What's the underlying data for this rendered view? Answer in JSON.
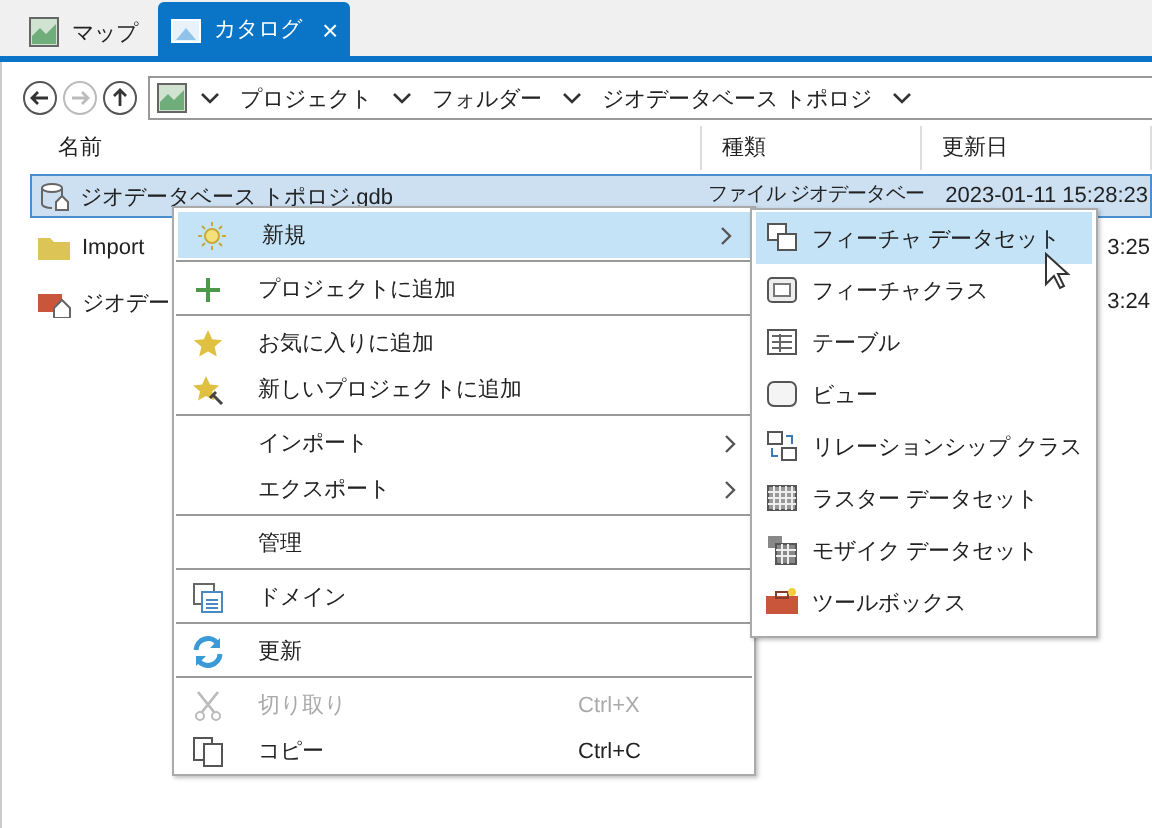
{
  "tabs": [
    {
      "label": "マップ",
      "selected": false
    },
    {
      "label": "カタログ",
      "selected": true,
      "close": "×"
    }
  ],
  "breadcrumb": {
    "items": [
      "プロジェクト",
      "フォルダー",
      "ジオデータベース トポロジ"
    ]
  },
  "table": {
    "columns": [
      "名前",
      "種類",
      "更新日"
    ],
    "rows": [
      {
        "name": "ジオデータベース トポロジ.gdb",
        "type": "ファイル ジオデータベー",
        "modified": "2023-01-11 15:28:23",
        "selected": true
      },
      {
        "name": "Import",
        "modified": "3:25",
        "selected": false
      },
      {
        "name": "ジオデー",
        "modified": "3:24",
        "selected": false
      }
    ]
  },
  "context_menu": {
    "items": [
      {
        "kind": "item",
        "label": "新規",
        "selected": true,
        "submenu": true
      },
      {
        "kind": "separator"
      },
      {
        "kind": "item",
        "label": "プロジェクトに追加",
        "selected": false,
        "submenu": false
      },
      {
        "kind": "separator"
      },
      {
        "kind": "item",
        "label": "お気に入りに追加",
        "selected": false,
        "submenu": false
      },
      {
        "kind": "item",
        "label": "新しいプロジェクトに追加",
        "selected": false,
        "submenu": false
      },
      {
        "kind": "separator"
      },
      {
        "kind": "item",
        "label": "インポート",
        "selected": false,
        "submenu": true
      },
      {
        "kind": "item",
        "label": "エクスポート",
        "selected": false,
        "submenu": true
      },
      {
        "kind": "separator"
      },
      {
        "kind": "item",
        "label": "管理",
        "selected": false,
        "submenu": false
      },
      {
        "kind": "separator"
      },
      {
        "kind": "item",
        "label": "ドメイン",
        "selected": false,
        "submenu": false
      },
      {
        "kind": "separator"
      },
      {
        "kind": "item",
        "label": "更新",
        "selected": false,
        "submenu": false
      },
      {
        "kind": "separator"
      },
      {
        "kind": "item",
        "label": "切り取り",
        "shortcut": "Ctrl+X",
        "disabled": true,
        "selected": false,
        "submenu": false
      },
      {
        "kind": "item",
        "label": "コピー",
        "shortcut": "Ctrl+C",
        "selected": false,
        "submenu": false
      }
    ]
  },
  "submenu": {
    "items": [
      {
        "label": "フィーチャ データセット",
        "selected": true
      },
      {
        "label": "フィーチャクラス",
        "selected": false
      },
      {
        "label": "テーブル",
        "selected": false
      },
      {
        "label": "ビュー",
        "selected": false
      },
      {
        "label": "リレーションシップ クラス",
        "selected": false
      },
      {
        "label": "ラスター データセット",
        "selected": false
      },
      {
        "label": "モザイク データセット",
        "selected": false
      },
      {
        "label": "ツールボックス",
        "selected": false
      }
    ]
  }
}
